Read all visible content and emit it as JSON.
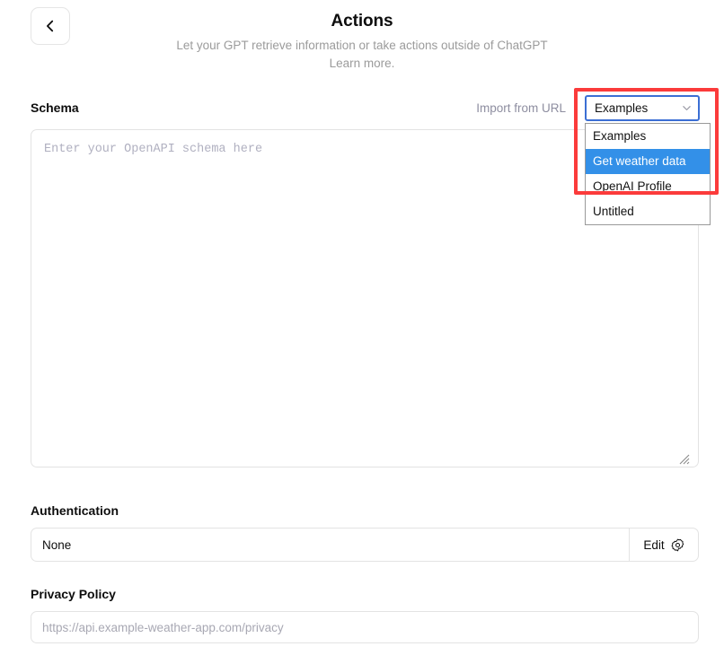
{
  "header": {
    "back_icon": "chevron-left-icon",
    "title": "Actions",
    "subtitle": "Let your GPT retrieve information or take actions outside of ChatGPT",
    "learn_more": "Learn more."
  },
  "schema": {
    "label": "Schema",
    "import_from_url": "Import from URL",
    "placeholder": "Enter your OpenAPI schema here",
    "value": ""
  },
  "examples_dropdown": {
    "selected": "Examples",
    "chevron_icon": "chevron-down-icon",
    "open": true,
    "options": [
      {
        "label": "Examples",
        "highlighted": false
      },
      {
        "label": "Get weather data",
        "highlighted": true
      },
      {
        "label": "OpenAI Profile",
        "highlighted": false
      },
      {
        "label": "Untitled",
        "highlighted": false
      }
    ],
    "focus_border_color": "#3b6fd4",
    "highlight_color": "#3390e8",
    "annotation_color": "#fb3b3b"
  },
  "authentication": {
    "label": "Authentication",
    "value": "None",
    "edit_label": "Edit",
    "edit_icon": "gear-icon"
  },
  "privacy_policy": {
    "label": "Privacy Policy",
    "placeholder": "https://api.example-weather-app.com/privacy",
    "value": ""
  }
}
